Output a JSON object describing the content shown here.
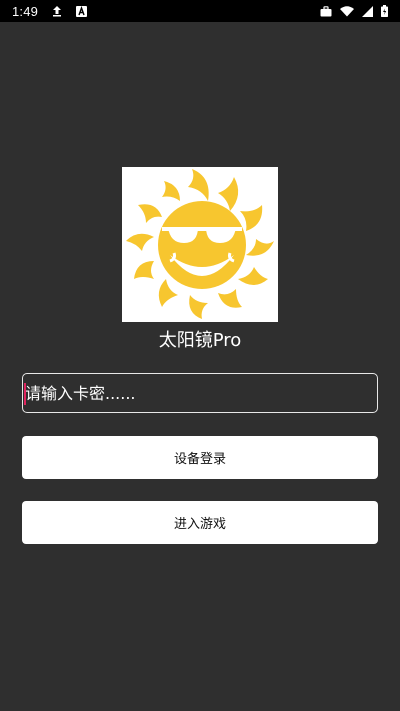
{
  "status_bar": {
    "time": "1:49",
    "icons": [
      "upload-icon",
      "a-notification-icon",
      "briefcase-icon",
      "wifi-icon",
      "signal-icon",
      "battery-icon"
    ]
  },
  "app": {
    "title": "太阳镜Pro",
    "logo": "sun-with-sunglasses-logo"
  },
  "card_input": {
    "placeholder": "请输入卡密......",
    "value": ""
  },
  "buttons": {
    "device_login": "设备登录",
    "enter_game": "进入游戏"
  },
  "colors": {
    "background": "#2f2f2f",
    "status_bar": "#000000",
    "button_bg": "#ffffff",
    "sun_yellow": "#f7c62f",
    "cursor": "#e0245e"
  }
}
